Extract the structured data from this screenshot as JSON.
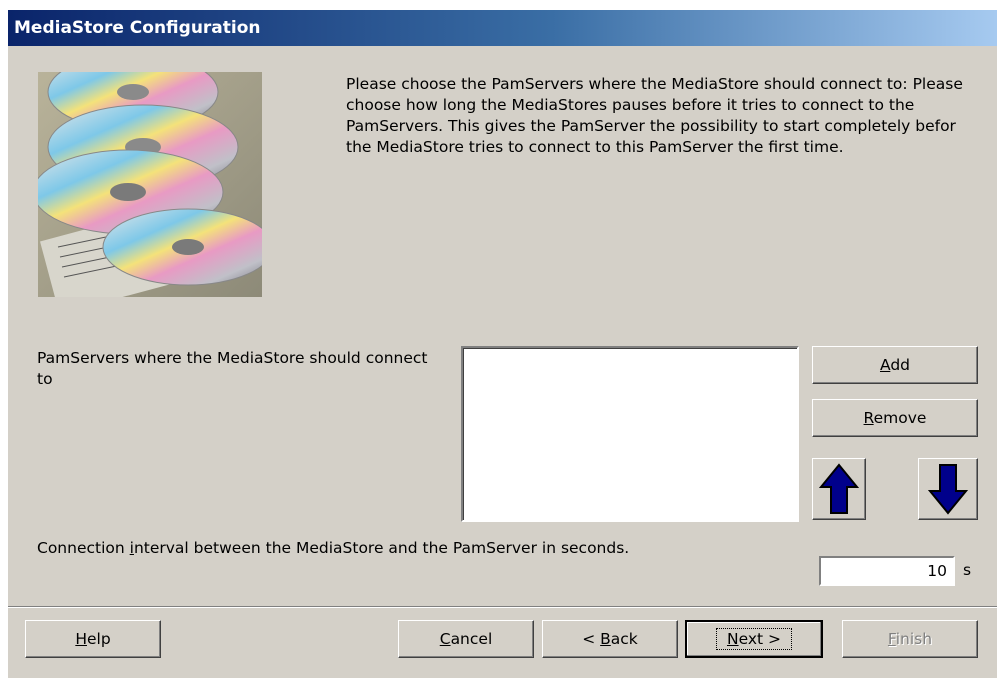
{
  "window": {
    "title": "MediaStore Configuration"
  },
  "intro_text": "Please choose the PamServers where the MediaStore should connect to: Please choose how long the MediaStores pauses before it tries to connect to the PamServers. This gives the PamServer the possibility to start completely befor the MediaStore tries to connect to this PamServer the first time.",
  "servers": {
    "label": "PamServers where the MediaStore should connect to",
    "items": [],
    "add_label": {
      "pre": "",
      "key": "A",
      "post": "dd"
    },
    "remove_label": {
      "pre": "",
      "key": "R",
      "post": "emove"
    },
    "up_icon": "arrow-up-icon",
    "down_icon": "arrow-down-icon"
  },
  "interval": {
    "label_pre": "Connection ",
    "label_key": "i",
    "label_post": "nterval between the MediaStore and the PamServer in seconds.",
    "value": "10",
    "unit": "s"
  },
  "footer": {
    "help": {
      "pre": "",
      "key": "H",
      "post": "elp"
    },
    "cancel": {
      "pre": "",
      "key": "C",
      "post": "ancel"
    },
    "back": {
      "pre": "< ",
      "key": "B",
      "post": "ack"
    },
    "next": {
      "pre": "",
      "key": "N",
      "post": "ext >"
    },
    "finish": {
      "pre": "",
      "key": "F",
      "post": "inish"
    }
  },
  "colors": {
    "face": "#d4d0c8",
    "title_start": "#0a246a",
    "title_end": "#a6caf0",
    "arrow_fill": "#00008b"
  }
}
